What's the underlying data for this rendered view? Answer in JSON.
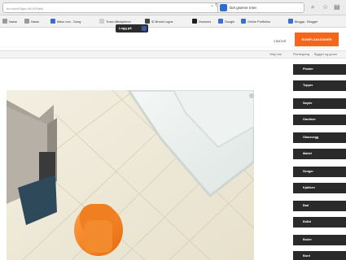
{
  "browser": {
    "url": "bo.no/rb/Taps-nb-HOdbd/",
    "search_badge": "G",
    "search_text": "Det grønne rrser"
  },
  "bookmarks": [
    {
      "label": "Nasai",
      "color": "#9a9a9a"
    },
    {
      "label": "Nasai",
      "color": "#9a9a9a"
    },
    {
      "label": "Maso mrs - Gong",
      "color": "#3a6fd0"
    },
    {
      "label": "Tross officiaplemo",
      "color": "#cfcfcf"
    },
    {
      "label": "ID Brand Logos",
      "color": "#444444"
    },
    {
      "label": "Nomums",
      "color": "#1e1e1e"
    },
    {
      "label": "Google",
      "color": "#3a6fd0"
    },
    {
      "label": "Online Portfolios",
      "color": "#3a6fd0"
    },
    {
      "label": "Blogga - Blogger",
      "color": "#3a6fd0"
    }
  ],
  "login": {
    "label": "Logg på"
  },
  "nav": {
    "items": [
      "VIMDAR"
    ],
    "active": "ROMPLANLEGGER",
    "accent": "#f5661b"
  },
  "subnav": [
    "Velg rom",
    "Plantegning",
    "Bygger og grunn"
  ],
  "sidebar": {
    "items": [
      "Planter",
      "Tepper",
      "Søyler",
      "Gardiner",
      "Glassvegg",
      "Møbel",
      "Senger",
      "Kjøkken",
      "Bad",
      "Bråtd",
      "Boder",
      "Bord"
    ]
  }
}
